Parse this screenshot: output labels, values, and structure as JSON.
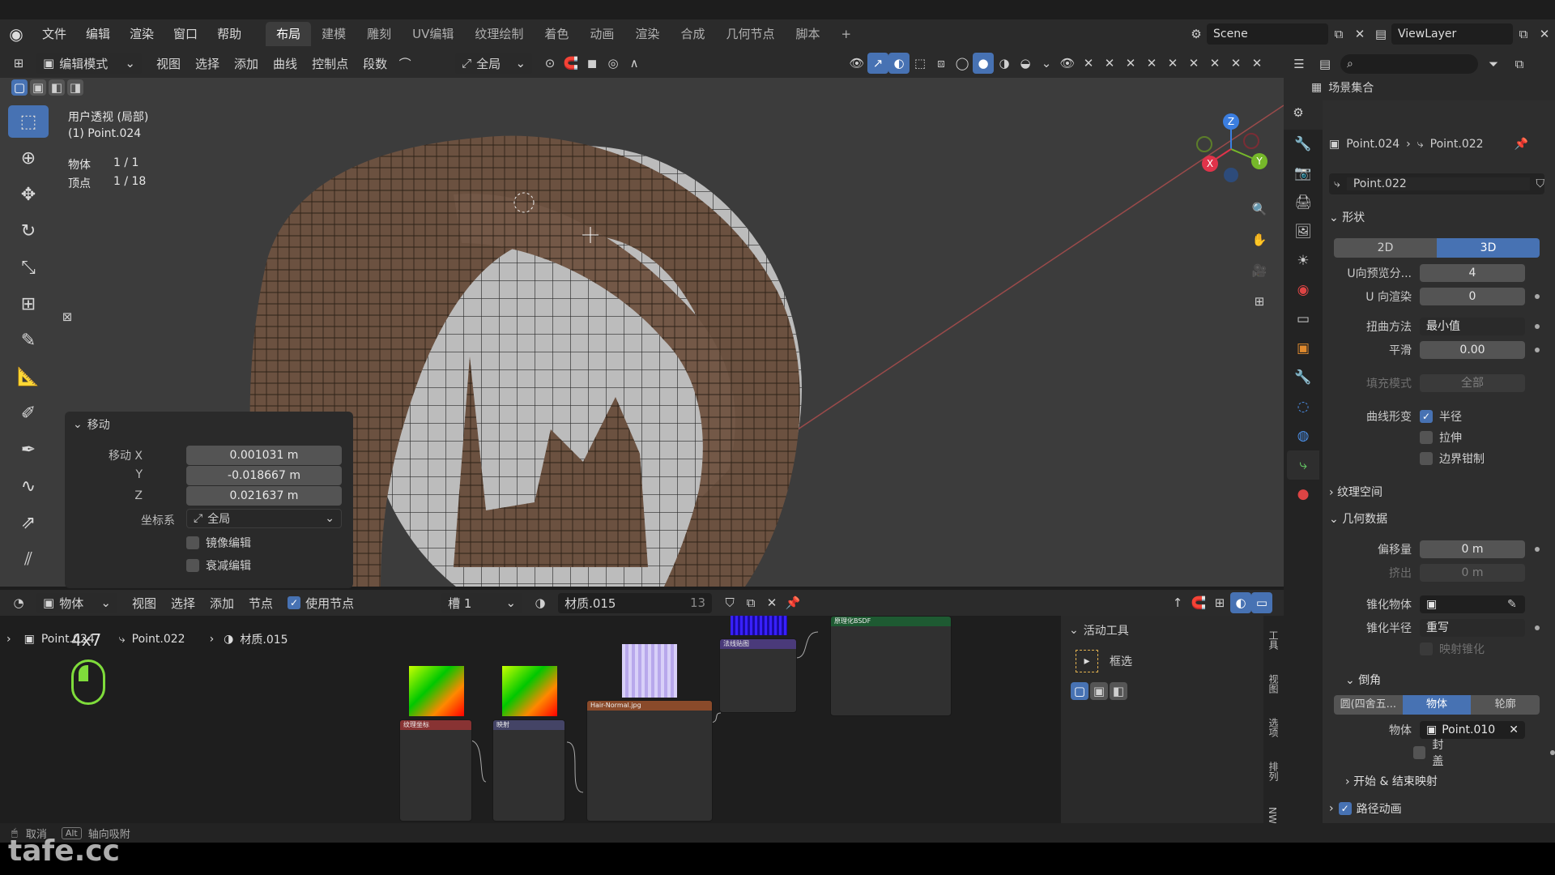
{
  "app": {
    "menus": [
      "文件",
      "编辑",
      "渲染",
      "窗口",
      "帮助"
    ],
    "workspaces": [
      "布局",
      "建模",
      "雕刻",
      "UV编辑",
      "纹理绘制",
      "着色",
      "动画",
      "渲染",
      "合成",
      "几何节点",
      "脚本"
    ],
    "active_workspace": "布局",
    "scene": "Scene",
    "view_layer": "ViewLayer"
  },
  "viewport": {
    "mode": "编辑模式",
    "menus": [
      "视图",
      "选择",
      "添加",
      "曲线",
      "控制点",
      "段数"
    ],
    "transform_orientation": "全局",
    "view_name": "用户透视 (局部)",
    "active_object": "(1) Point.024",
    "stats": [
      {
        "label": "物体",
        "value": "1 / 1"
      },
      {
        "label": "顶点",
        "value": "1 / 18"
      }
    ],
    "gizmo": {
      "x": "X",
      "y": "Y",
      "z": "Z"
    },
    "colors": {
      "bg": "#3c3c3c",
      "hair": "#6b5140",
      "scalp": "#b9b9b9"
    }
  },
  "operator_panel": {
    "title": "移动",
    "fields": [
      {
        "label": "移动 X",
        "value": "0.001031 m"
      },
      {
        "label": "Y",
        "value": "-0.018667 m"
      },
      {
        "label": "Z",
        "value": "0.021637 m"
      }
    ],
    "coord_label": "坐标系",
    "coord_value": "全局",
    "checkboxes": [
      {
        "label": "镜像编辑",
        "checked": false
      },
      {
        "label": "衰减编辑",
        "checked": false
      }
    ]
  },
  "outliner": {
    "title": "场景集合"
  },
  "properties": {
    "breadcrumb": [
      "Point.024",
      "Point.022"
    ],
    "data_name": "Point.022",
    "shape": {
      "title": "形状",
      "mode_2d": "2D",
      "mode_3d": "3D",
      "rows": [
        {
          "label": "U向预览分...",
          "value": "4"
        },
        {
          "label": "U 向渲染",
          "value": "0"
        },
        {
          "label": "扭曲方法",
          "value": "最小值"
        },
        {
          "label": "平滑",
          "value": "0.00"
        },
        {
          "label": "填充模式",
          "value": "全部"
        }
      ],
      "deform_label": "曲线形变",
      "deform_options": [
        {
          "label": "半径",
          "checked": true
        },
        {
          "label": "拉伸",
          "checked": false
        },
        {
          "label": "边界钳制",
          "checked": false
        }
      ]
    },
    "texture_space": "纹理空间",
    "geometry": {
      "title": "几何数据",
      "rows": [
        {
          "label": "偏移量",
          "value": "0 m"
        },
        {
          "label": "挤出",
          "value": "0 m"
        },
        {
          "label": "锥化物体",
          "value": ""
        },
        {
          "label": "锥化半径",
          "value": "重写"
        }
      ],
      "map_taper": "映射锥化"
    },
    "bevel": {
      "title": "倒角",
      "modes": [
        "圆(四舍五...",
        "物体",
        "轮廓"
      ],
      "active_mode": "物体",
      "object_label": "物体",
      "object_value": "Point.010",
      "fill_caps": "封盖"
    },
    "start_end": "开始 & 结束映射",
    "path_anim": "路径动画"
  },
  "node_editor": {
    "type_label": "物体",
    "menus": [
      "视图",
      "选择",
      "添加",
      "节点"
    ],
    "use_nodes": "使用节点",
    "slot": "槽 1",
    "material": "材质.015",
    "user_count": "13",
    "breadcrumb": [
      "Point.024",
      "Point.022",
      "材质.015"
    ],
    "zoom_overlay": "4x7",
    "nodes": [
      {
        "title": "纹理坐标"
      },
      {
        "title": "映射"
      },
      {
        "title": "Hair-Normal.jpg"
      },
      {
        "title": "法线贴图"
      },
      {
        "title": "原理化BSDF"
      }
    ]
  },
  "active_tool_panel": {
    "title": "活动工具",
    "tool_name": "框选"
  },
  "side_tabs": [
    "工具",
    "视图",
    "选项",
    "排列",
    "NW"
  ],
  "status": {
    "cancel": "取消",
    "key": "Alt",
    "snap": "轴向吸附"
  },
  "watermark": "tafe.cc"
}
